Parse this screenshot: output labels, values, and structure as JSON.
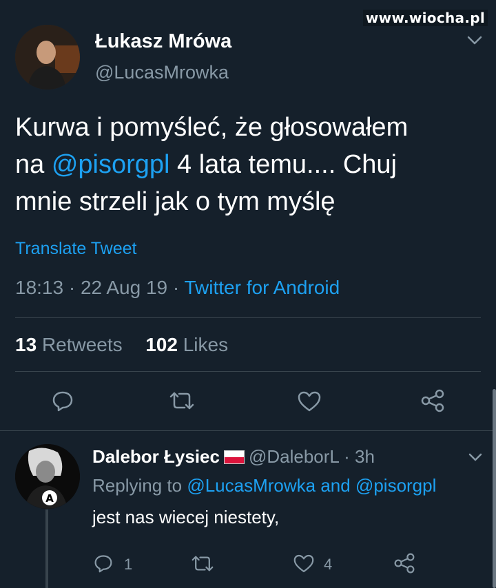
{
  "watermark": "www.wiocha.pl",
  "tweet": {
    "author_name": "Łukasz Mrówa",
    "author_handle": "@LucasMrowka",
    "text_line1": "Kurwa i pomyśleć, że głosowałem",
    "text_line2_prefix": "na ",
    "text_mention": "@pisorgpl",
    "text_line2_suffix": " 4 lata temu.... Chuj",
    "text_line3": "mnie strzeli jak o tym myślę",
    "translate_label": "Translate Tweet",
    "time": "18:13",
    "separator": " · ",
    "date": "22 Aug 19",
    "source": "Twitter for Android",
    "retweets_count": "13",
    "retweets_label": "Retweets",
    "likes_count": "102",
    "likes_label": "Likes"
  },
  "reply": {
    "author_name": "Dalebor Łysiec",
    "author_handle": "@DaleborL",
    "separator": " · ",
    "age": "3h",
    "replying_prefix": "Replying to ",
    "replying_to_1": "@LucasMrowka",
    "replying_and": " and ",
    "replying_to_2": "@pisorgpl",
    "text": "jest nas wiecej niestety,",
    "reply_count": "1",
    "like_count": "4"
  },
  "icons": {
    "reply": "reply-icon",
    "retweet": "retweet-icon",
    "like": "heart-icon",
    "share": "share-icon",
    "more": "chevron-down-icon",
    "flag": "poland-flag-icon"
  },
  "colors": {
    "background": "#15202b",
    "accent": "#1da1f2",
    "secondary_text": "#8899a6",
    "divider": "#38444d"
  }
}
